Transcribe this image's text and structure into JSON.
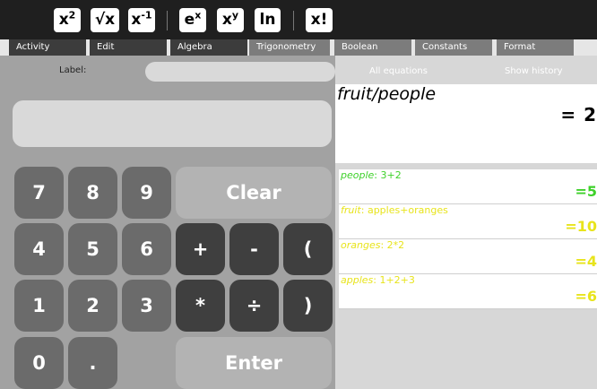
{
  "toolbar": {
    "buttons": [
      {
        "base": "x",
        "sup": "2"
      },
      {
        "base": "√x",
        "sup": ""
      },
      {
        "base": "x",
        "sup": "-1"
      },
      {
        "base": "e",
        "sup": "x"
      },
      {
        "base": "x",
        "sup": "y"
      },
      {
        "base": "ln",
        "sup": ""
      },
      {
        "base": "x!",
        "sup": ""
      }
    ]
  },
  "tabs": [
    "Activity",
    "Edit",
    "Algebra",
    "Trigonometry",
    "Boolean",
    "Constants",
    "Format"
  ],
  "label_text": "Label:",
  "label_value": "",
  "all_equations": "All equations",
  "show_history": "Show history",
  "equation": {
    "expr": "fruit/people",
    "result": "= 2"
  },
  "history": [
    {
      "name": "people",
      "expr": ": 3+2",
      "result": "=5",
      "color": "#3fd12b"
    },
    {
      "name": "fruit",
      "expr": ": apples+oranges",
      "result": "=10",
      "color": "#e8e41c"
    },
    {
      "name": "oranges",
      "expr": ": 2*2",
      "result": "=4",
      "color": "#e8e41c"
    },
    {
      "name": "apples",
      "expr": ": 1+2+3",
      "result": "=6",
      "color": "#e8e41c"
    }
  ],
  "keys": {
    "k7": "7",
    "k8": "8",
    "k9": "9",
    "clear": "Clear",
    "k4": "4",
    "k5": "5",
    "k6": "6",
    "plus": "+",
    "minus": "-",
    "lparen": "(",
    "k1": "1",
    "k2": "2",
    "k3": "3",
    "times": "*",
    "divide": "÷",
    "rparen": ")",
    "k0": "0",
    "dot": ".",
    "enter": "Enter"
  }
}
